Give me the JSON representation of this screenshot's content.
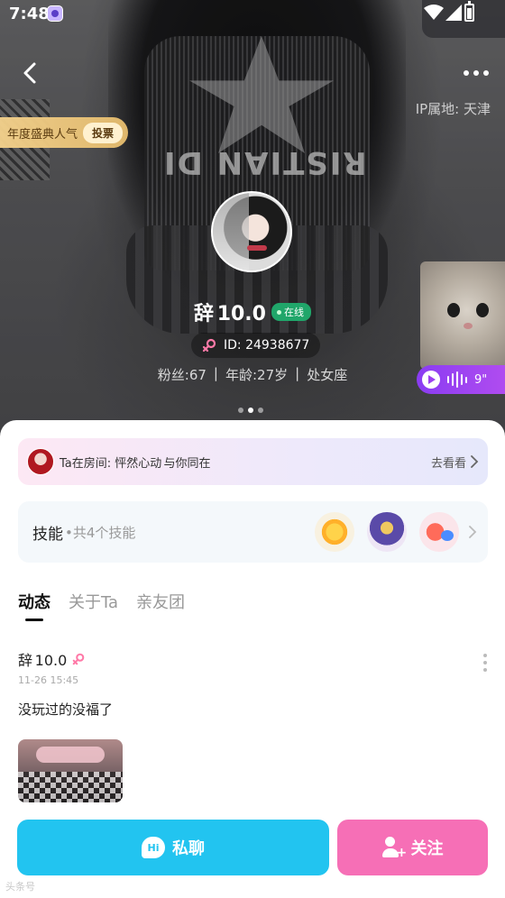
{
  "status_bar": {
    "time": "7:48"
  },
  "header": {
    "ip_location": "IP属地: 天津"
  },
  "award": {
    "label": "年度盛典人气",
    "vote_label": "投票"
  },
  "profile": {
    "nickname": "辞 ‍10.0",
    "online_label": "在线",
    "id_text": "ID: 24938677",
    "fans": "粉丝:67",
    "age": "年龄:27岁",
    "zodiac": "处女座",
    "separator": "|"
  },
  "voice": {
    "duration": "9\""
  },
  "room": {
    "text": "Ta在房间: 怦然心动 与你同在",
    "go_label": "去看看"
  },
  "skills": {
    "title": "技能",
    "subtitle": "•共4个技能"
  },
  "tabs": [
    {
      "label": "动态"
    },
    {
      "label": "关于Ta"
    },
    {
      "label": "亲友团"
    }
  ],
  "post": {
    "author": "辞 ‍10.0",
    "time": "11-26 15:45",
    "text": "没玩过的没福了"
  },
  "actions": {
    "chat_label": "私聊",
    "chat_icon_text": "Hi",
    "follow_label": "关注"
  },
  "watermark": "头条号",
  "colors": {
    "chat_button": "#22c4f0",
    "follow_button": "#f66fb6",
    "online_badge": "#20a66a",
    "voice_pill": "#9c40f0",
    "award": "#e8be6e"
  }
}
